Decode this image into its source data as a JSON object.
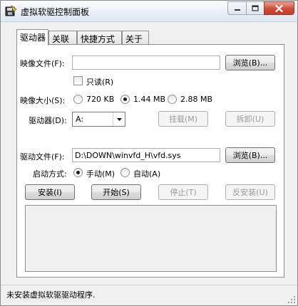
{
  "window": {
    "title": "虚拟软驱控制面板",
    "icon": "floppy-app-icon"
  },
  "tabs": [
    {
      "label": "驱动器",
      "active": true
    },
    {
      "label": "关联",
      "active": false
    },
    {
      "label": "快捷方式",
      "active": false
    },
    {
      "label": "关于",
      "active": false
    }
  ],
  "drive": {
    "image_file_label": "映像文件(F):",
    "image_file_value": "",
    "browse_label": "浏览(B)...",
    "readonly_label": "只读(R)",
    "readonly_checked": false,
    "image_size_label": "映像大小(S):",
    "sizes": [
      {
        "label": "720 KB",
        "selected": false
      },
      {
        "label": "1.44 MB",
        "selected": true
      },
      {
        "label": "2.88 MB",
        "selected": false
      }
    ],
    "drive_label": "驱动器(D):",
    "drive_value": "A:",
    "mount_label": "挂载(M)",
    "unmount_label": "拆卸(U)"
  },
  "driver": {
    "driver_file_label": "驱动文件(F):",
    "driver_file_value": "D:\\DOWN\\winvfd_H\\vfd.sys",
    "browse_label": "浏览(B)...",
    "start_mode_label": "启动方式:",
    "modes": [
      {
        "label": "手动(M)",
        "selected": true
      },
      {
        "label": "自动(A)",
        "selected": false
      }
    ],
    "install_label": "安装(I)",
    "start_label": "开始(S)",
    "stop_label": "停止(T)",
    "uninstall_label": "反安装(U)"
  },
  "status": {
    "text": "未安装虚拟软驱驱动程序."
  },
  "colors": {
    "window_bg": "#f0f0f0",
    "panel_bg": "#ffffff",
    "close_button": "#c7432f",
    "disabled_text": "#9b9b9b"
  }
}
